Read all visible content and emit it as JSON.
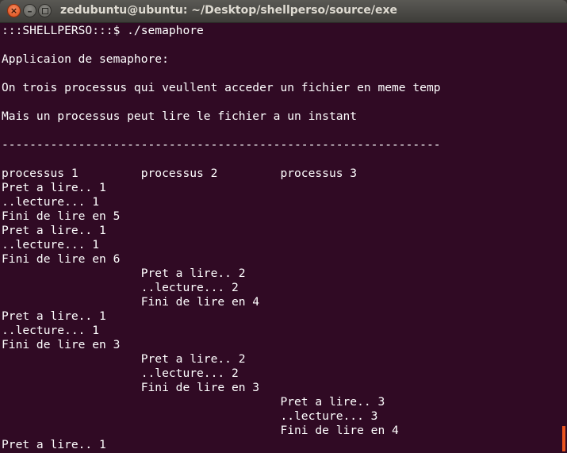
{
  "window": {
    "title": "zedubuntu@ubuntu: ~/Desktop/shellperso/source/exe",
    "close_glyph": "×",
    "minimize_glyph": "–"
  },
  "terminal": {
    "lines": [
      ":::SHELLPERSO:::$ ./semaphore",
      "",
      "Applicaion de semaphore:",
      "",
      "On trois processus qui veullent acceder un fichier en meme temp",
      "",
      "Mais un processus peut lire le fichier a un instant",
      "",
      "---------------------------------------------------------------",
      "",
      "processus 1         processus 2         processus 3",
      "Pret a lire.. 1",
      "..lecture... 1",
      "Fini de lire en 5",
      "Pret a lire.. 1",
      "..lecture... 1",
      "Fini de lire en 6",
      "                    Pret a lire.. 2",
      "                    ..lecture... 2",
      "                    Fini de lire en 4",
      "Pret a lire.. 1",
      "..lecture... 1",
      "Fini de lire en 3",
      "                    Pret a lire.. 2",
      "                    ..lecture... 2",
      "                    Fini de lire en 3",
      "                                        Pret a lire.. 3",
      "                                        ..lecture... 3",
      "                                        Fini de lire en 4",
      "Pret a lire.. 1"
    ]
  },
  "colors": {
    "terminal_bg": "#300a24",
    "terminal_fg": "#ffffff",
    "titlebar_fg": "#dfdbd2",
    "accent": "#e95420"
  }
}
